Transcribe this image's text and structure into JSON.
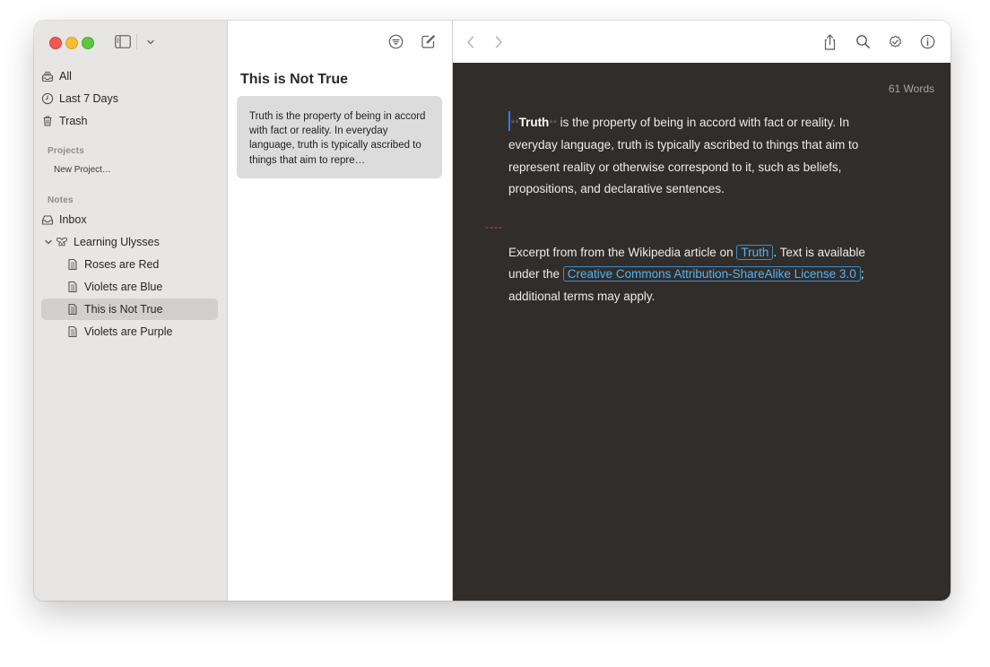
{
  "sidebar": {
    "library": [
      {
        "label": "All",
        "icon": "tray-stack-icon"
      },
      {
        "label": "Last 7 Days",
        "icon": "clock-icon"
      },
      {
        "label": "Trash",
        "icon": "trash-icon"
      }
    ],
    "projects_heading": "Projects",
    "new_project": "New Project…",
    "notes_heading": "Notes",
    "inbox": "Inbox",
    "group": "Learning Ulysses",
    "sheets": [
      {
        "label": "Roses are Red"
      },
      {
        "label": "Violets are Blue"
      },
      {
        "label": "This is Not True",
        "selected": true
      },
      {
        "label": "Violets are Purple"
      }
    ]
  },
  "sheet_list": {
    "title": "This is Not True",
    "cards": [
      {
        "preview": "Truth is the property of being in accord with fact or reality. In everyday language, truth is typically ascribed to things that aim to repre…"
      }
    ]
  },
  "editor": {
    "word_count": "61 Words",
    "paragraph1": {
      "mark_open": "**",
      "bold": "Truth",
      "mark_close": "**",
      "text": " is the property of being in accord with fact or reality. In everyday language, truth is typically ascribed to things that aim to represent reality or otherwise correspond to it, such as beliefs, propositions, and declarative sentences."
    },
    "divider": "----",
    "paragraph2": {
      "before": "Excerpt from from the Wikipedia article on ",
      "link1": "Truth",
      "middle": ". Text is available under the ",
      "link2": "Creative Commons Attribution-ShareAlike License 3.0",
      "after": "; additional terms may apply."
    }
  },
  "colors": {
    "editor_bg": "#312d2b",
    "link": "#55b3f0",
    "cursor": "#3478f6",
    "divider_mark": "#d9473f"
  }
}
